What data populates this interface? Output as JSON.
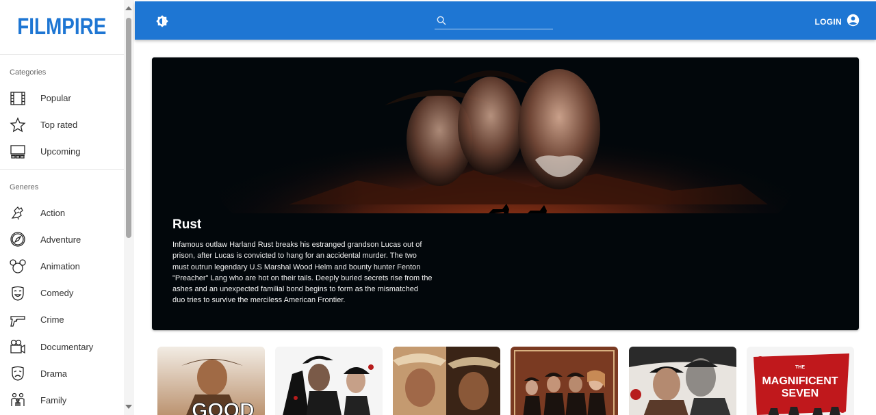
{
  "app": {
    "logo": "FILMPIRE"
  },
  "sidebar": {
    "categories_title": "Categories",
    "categories": [
      {
        "label": "Popular",
        "icon": "film-icon"
      },
      {
        "label": "Top rated",
        "icon": "star-icon"
      },
      {
        "label": "Upcoming",
        "icon": "cinema-icon"
      }
    ],
    "genres_title": "Generes",
    "genres": [
      {
        "label": "Action",
        "icon": "action-icon"
      },
      {
        "label": "Adventure",
        "icon": "compass-icon"
      },
      {
        "label": "Animation",
        "icon": "mouse-ears-icon"
      },
      {
        "label": "Comedy",
        "icon": "comedy-mask-icon"
      },
      {
        "label": "Crime",
        "icon": "gun-icon"
      },
      {
        "label": "Documentary",
        "icon": "camera-icon"
      },
      {
        "label": "Drama",
        "icon": "drama-mask-icon"
      },
      {
        "label": "Family",
        "icon": "family-icon"
      }
    ]
  },
  "topbar": {
    "search": {
      "placeholder": "",
      "value": ""
    },
    "login_label": "LOGIN"
  },
  "featured": {
    "title": "Rust",
    "overview": "Infamous outlaw Harland Rust breaks his estranged grandson Lucas out of prison, after Lucas is convicted to hang for an accidental murder. The two must outrun legendary U.S Marshal Wood Helm and bounty hunter Fenton \"Preacher\" Lang who are hot on their tails. Deeply buried secrets rise from the ashes and an unexpected familial bond begins to form as the mismatched duo tries to survive the merciless American Frontier."
  },
  "movies": [
    {
      "poster_text": "GOOD"
    },
    {
      "poster_text": ""
    },
    {
      "poster_text": ""
    },
    {
      "poster_text": ""
    },
    {
      "poster_text": ""
    },
    {
      "poster_text_line1": "THE",
      "poster_text_line2": "MAGNIFICENT",
      "poster_text_line3": "SEVEN"
    }
  ],
  "colors": {
    "primary": "#1e76d3",
    "hero_bg": "#02070b"
  }
}
